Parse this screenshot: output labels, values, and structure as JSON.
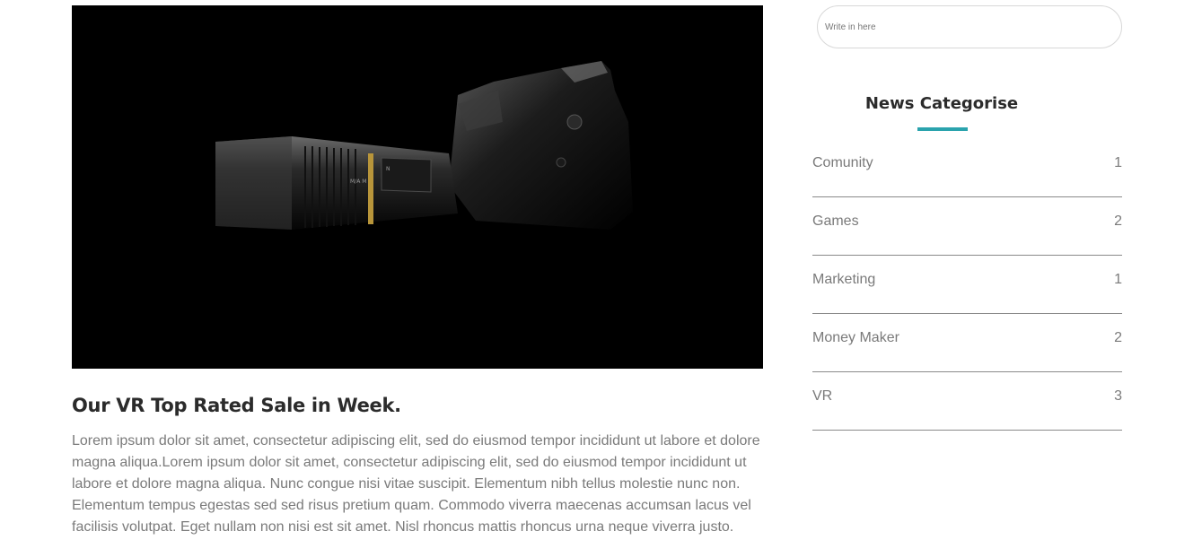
{
  "main": {
    "image_alt": "Camera with lens in dark",
    "post_title": "Our VR Top Rated Sale in Week.",
    "post_body": "Lorem ipsum dolor sit amet, consectetur adipiscing elit, sed do eiusmod tempor incididunt ut labore et dolore magna aliqua.Lorem ipsum dolor sit amet, consectetur adipiscing elit, sed do eiusmod tempor incididunt ut labore et dolore magna aliqua. Nunc congue nisi vitae suscipit. Elementum nibh tellus molestie nunc non. Elementum tempus egestas sed sed risus pretium quam. Commodo viverra maecenas accumsan lacus vel facilisis volutpat. Eget nullam non nisi est sit amet. Nisl rhoncus mattis rhoncus urna neque viverra justo."
  },
  "sidebar": {
    "search": {
      "placeholder": "Write in here"
    },
    "categories_title": "News Categorise",
    "categories": [
      {
        "label": "Comunity",
        "count": "1"
      },
      {
        "label": "Games",
        "count": "2"
      },
      {
        "label": "Marketing",
        "count": "1"
      },
      {
        "label": "Money Maker",
        "count": "2"
      },
      {
        "label": "VR",
        "count": "3"
      }
    ]
  },
  "colors": {
    "accent": "#2aa3ad",
    "heading": "#2b2b2b",
    "body_text": "#7a7a7a",
    "divider": "#8a8a8a"
  }
}
